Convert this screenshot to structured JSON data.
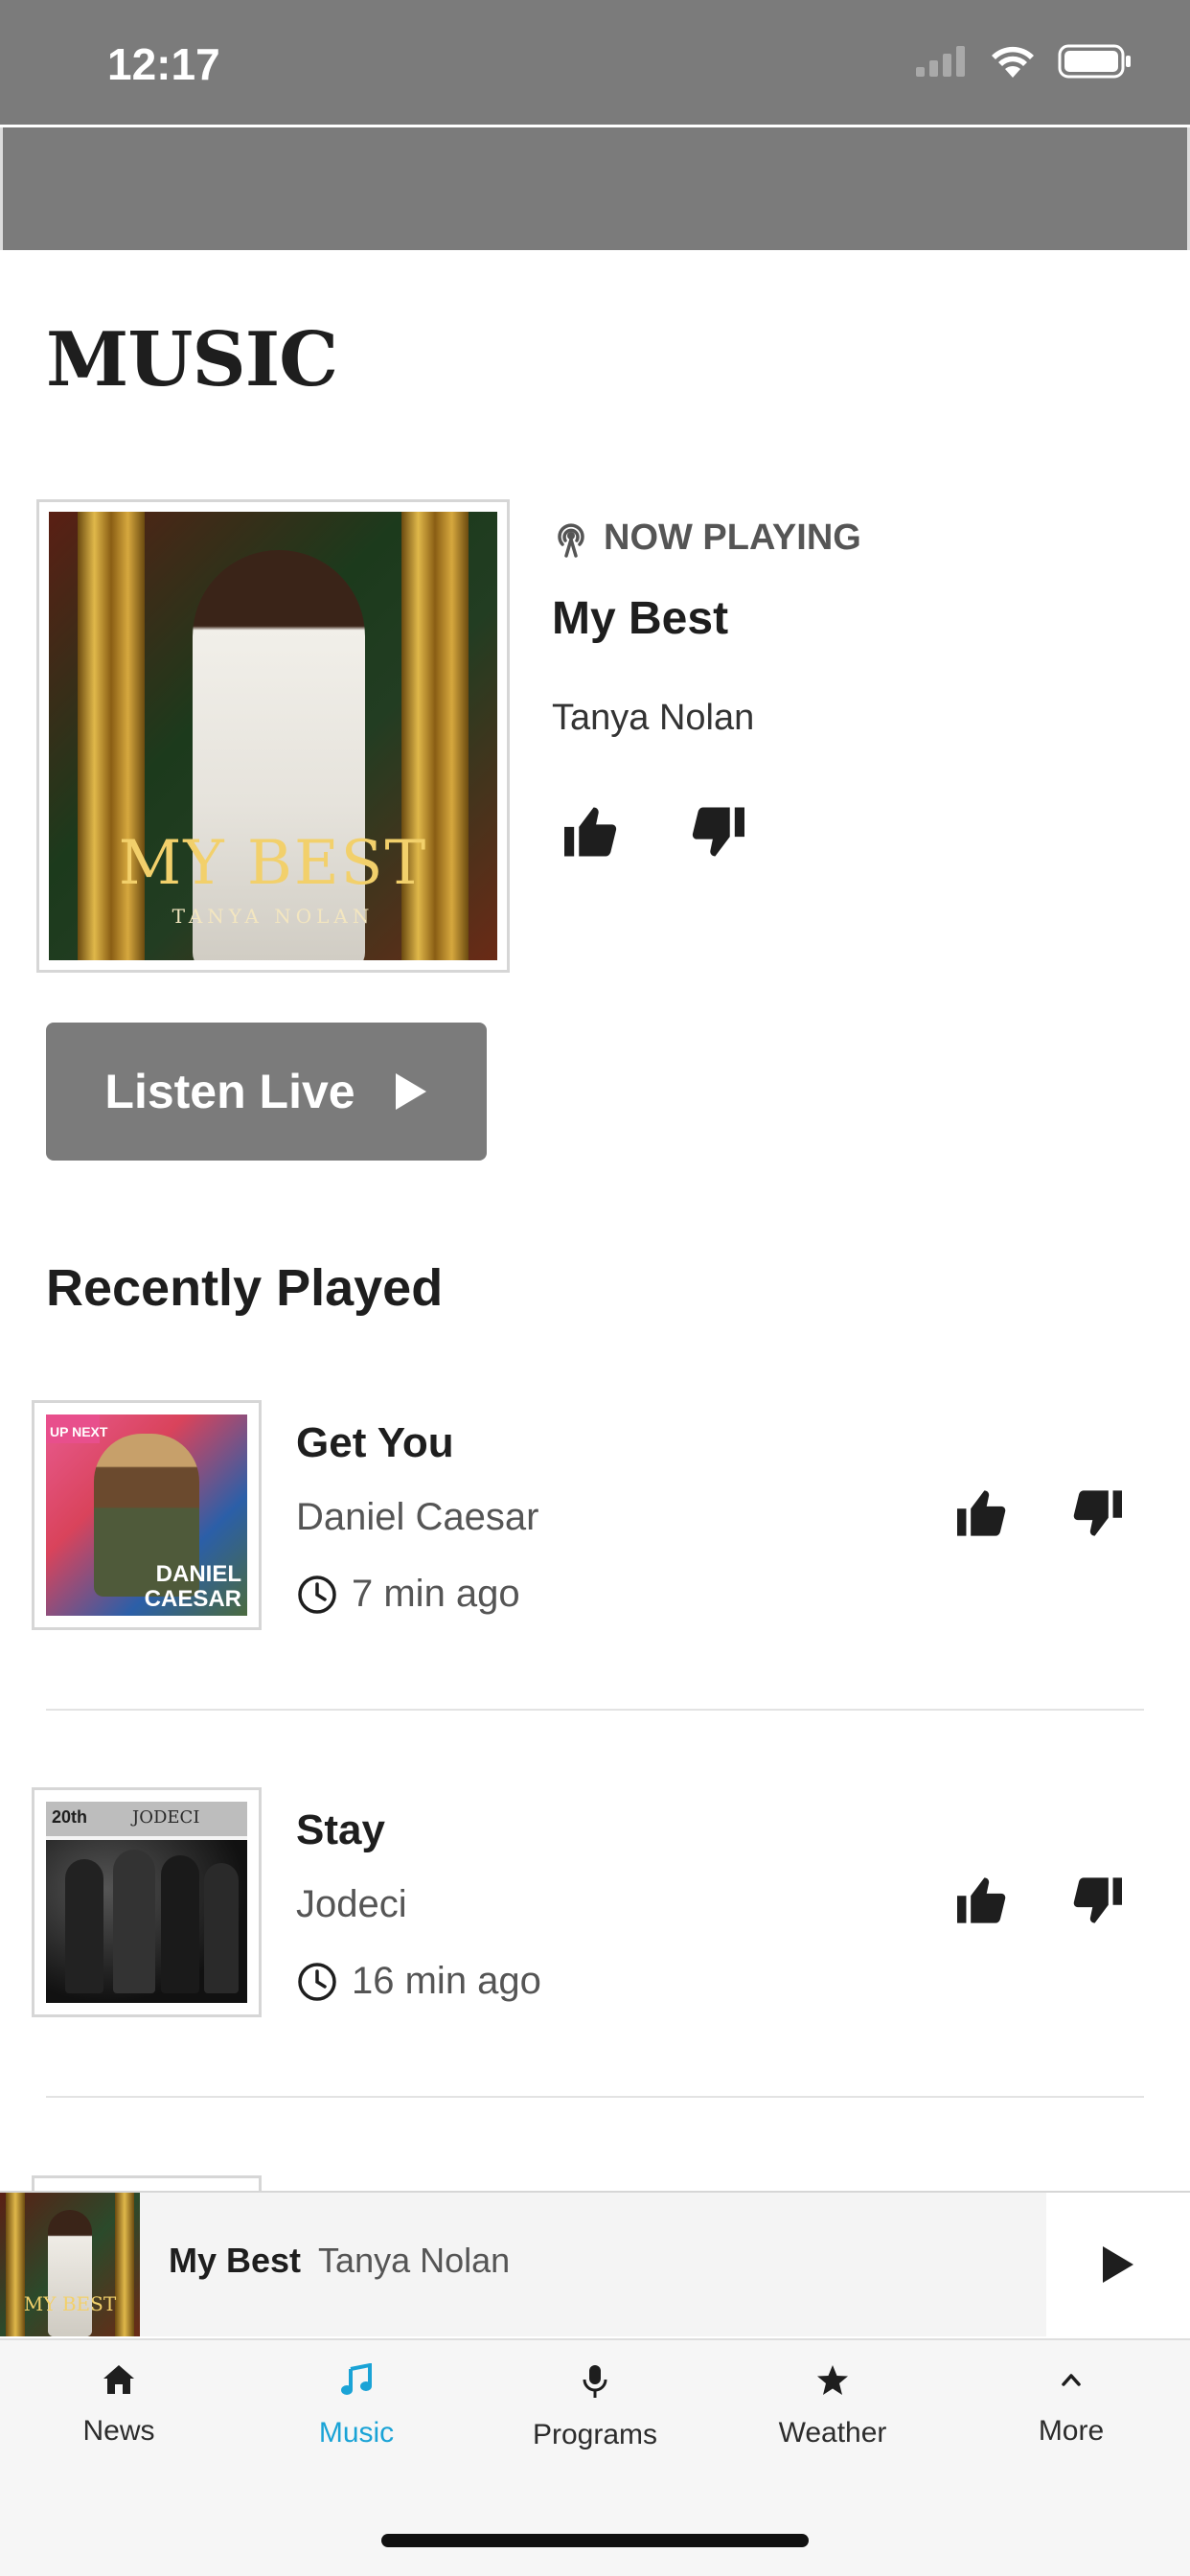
{
  "status_bar": {
    "time": "12:17"
  },
  "page": {
    "title": "MUSIC"
  },
  "now_playing": {
    "label": "NOW PLAYING",
    "song": "My Best",
    "artist": "Tanya Nolan",
    "album_text": "MY BEST",
    "album_artist_text": "TANYA NOLAN"
  },
  "listen_live": {
    "label": "Listen Live"
  },
  "recently_played": {
    "title": "Recently Played",
    "items": [
      {
        "song": "Get You",
        "artist": "Daniel Caesar",
        "time": "7 min ago",
        "cover_text": "DANIEL CAESAR",
        "cover_badge": "UP NEXT"
      },
      {
        "song": "Stay",
        "artist": "Jodeci",
        "time": "16 min ago",
        "cover_text": "JODECI",
        "cover_badge": "20th"
      }
    ]
  },
  "mini_player": {
    "song": "My Best",
    "artist": "Tanya Nolan",
    "album_text": "MY BEST"
  },
  "tabs": [
    {
      "label": "News",
      "icon": "home-icon",
      "active": false
    },
    {
      "label": "Music",
      "icon": "music-note-icon",
      "active": true
    },
    {
      "label": "Programs",
      "icon": "microphone-icon",
      "active": false
    },
    {
      "label": "Weather",
      "icon": "star-icon",
      "active": false
    },
    {
      "label": "More",
      "icon": "chevron-up-icon",
      "active": false
    }
  ],
  "colors": {
    "accent": "#1aa3d6",
    "header_gray": "#7b7b7b",
    "text_dark": "#1e1e1e"
  }
}
